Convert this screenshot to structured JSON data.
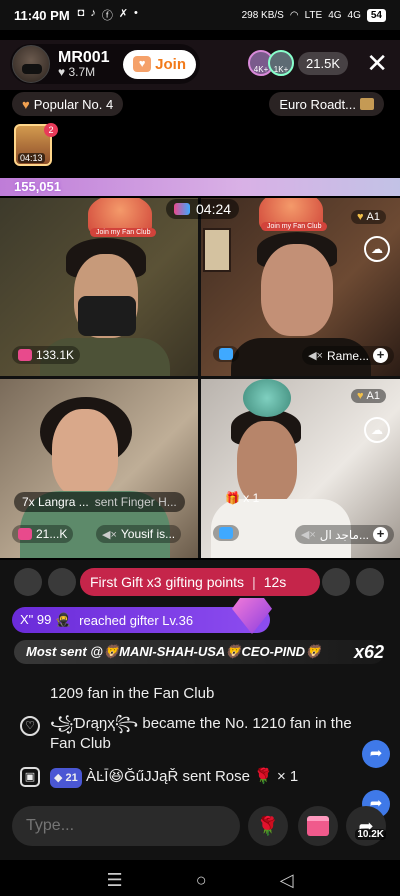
{
  "status": {
    "time": "11:40 PM",
    "app_icons": [
      "◘",
      "♪",
      "ⓕ",
      "✗",
      "•"
    ],
    "net_speed": "298 KB/S",
    "lte": "LTE",
    "signal": "4G",
    "signal2": "4G",
    "battery": "54"
  },
  "host": {
    "name": "MR001",
    "likes": "3.7M",
    "join_label": "Join"
  },
  "viewers": {
    "count": "21.5K",
    "avatar1_badge": "4K+",
    "avatar2_badge": "1K+"
  },
  "tags": {
    "popular": "Popular No. 4",
    "region": "Euro Roadt..."
  },
  "chest": {
    "badge": "2",
    "timer": "04:13"
  },
  "score": "155,051",
  "battle": {
    "timer": "04:24"
  },
  "cells": [
    {
      "fan_label": "Join my Fan Club",
      "count": "133.1K"
    },
    {
      "fan_label": "Join my Fan Club",
      "name": "Rame...",
      "badge": "A1"
    },
    {
      "count": "21...K",
      "name": "Yousif is..."
    },
    {
      "name": "ماجد ال...",
      "badge": "A1",
      "gift_mult": "x 1"
    }
  ],
  "gift_notice": {
    "user": "7x Langra ...",
    "action": "sent Finger H..."
  },
  "gift_banner": {
    "text": "First Gift x3 gifting points",
    "time": "12s"
  },
  "level_banner": {
    "user": "X\" 99 🥷",
    "text": "reached gifter Lv.36"
  },
  "most_sent": {
    "text": "Most sent @🦁MANI-SHAH-USA🦁CEO-PIND🦁",
    "mult": "x62"
  },
  "chat": [
    {
      "text": "1209 fan in the Fan Club"
    },
    {
      "text": "꧁Ɗɾąŋҳ꧂ became the No. 1210 fan in the Fan Club"
    },
    {
      "level": "21",
      "text": "ÀĿĪ😆ĞűJJąŘ sent Rose 🌹 × 1"
    }
  ],
  "input": {
    "placeholder": "Type..."
  },
  "share_count": "10.2K",
  "nav": {
    "menu": "☰",
    "home": "○",
    "back": "◁"
  },
  "colors": {
    "accent": "#c5254a",
    "join_text": "#f27a1a",
    "level_banner": "#6a2bd9",
    "share": "#3f79e8"
  }
}
